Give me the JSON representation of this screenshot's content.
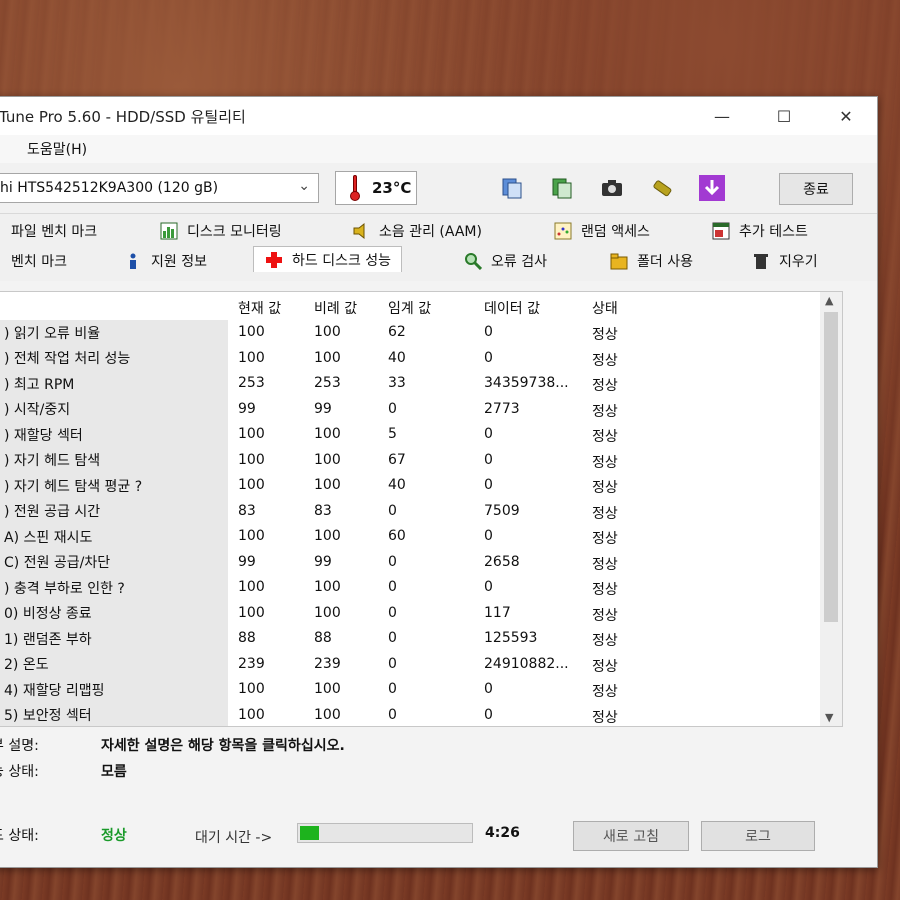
{
  "window": {
    "title": "Tune Pro 5.60 - HDD/SSD 유틸리티",
    "minimize": "—",
    "maximize": "☐",
    "close": "✕"
  },
  "menu": {
    "help": "도움말(H)"
  },
  "toolbar": {
    "drive": "hi HTS542512K9A300 (120 gB)",
    "temperature": "23°C",
    "exit_label": "종료"
  },
  "tabs": {
    "row1": [
      "파일 벤치 마크",
      "디스크 모니터링",
      "소음 관리 (AAM)",
      "랜덤 액세스",
      "추가 테스트"
    ],
    "row2": [
      "벤치 마크",
      "지원 정보",
      "하드 디스크 성능",
      "오류 검사",
      "폴더 사용",
      "지우기"
    ]
  },
  "grid": {
    "headers": [
      "현재 값",
      "비례 값",
      "임계 값",
      "데이터 값",
      "상태"
    ],
    "rows": [
      {
        "name": ") 읽기 오류 비율",
        "cur": "100",
        "worst": "100",
        "thr": "62",
        "raw": "0",
        "status": "정상"
      },
      {
        "name": ") 전체 작업 처리 성능",
        "cur": "100",
        "worst": "100",
        "thr": "40",
        "raw": "0",
        "status": "정상"
      },
      {
        "name": ") 최고 RPM",
        "cur": "253",
        "worst": "253",
        "thr": "33",
        "raw": "34359738...",
        "status": "정상"
      },
      {
        "name": ") 시작/중지",
        "cur": "99",
        "worst": "99",
        "thr": "0",
        "raw": "2773",
        "status": "정상"
      },
      {
        "name": ") 재할당 섹터",
        "cur": "100",
        "worst": "100",
        "thr": "5",
        "raw": "0",
        "status": "정상"
      },
      {
        "name": ") 자기 헤드 탐색",
        "cur": "100",
        "worst": "100",
        "thr": "67",
        "raw": "0",
        "status": "정상"
      },
      {
        "name": ") 자기 헤드 탐색 평균 ?",
        "cur": "100",
        "worst": "100",
        "thr": "40",
        "raw": "0",
        "status": "정상"
      },
      {
        "name": ") 전원 공급 시간",
        "cur": "83",
        "worst": "83",
        "thr": "0",
        "raw": "7509",
        "status": "정상"
      },
      {
        "name": "A) 스핀 재시도",
        "cur": "100",
        "worst": "100",
        "thr": "60",
        "raw": "0",
        "status": "정상"
      },
      {
        "name": "C) 전원 공급/차단",
        "cur": "99",
        "worst": "99",
        "thr": "0",
        "raw": "2658",
        "status": "정상"
      },
      {
        "name": ") 충격 부하로 인한 ?",
        "cur": "100",
        "worst": "100",
        "thr": "0",
        "raw": "0",
        "status": "정상"
      },
      {
        "name": "0) 비정상 종료",
        "cur": "100",
        "worst": "100",
        "thr": "0",
        "raw": "117",
        "status": "정상"
      },
      {
        "name": "1) 랜덤존 부하",
        "cur": "88",
        "worst": "88",
        "thr": "0",
        "raw": "125593",
        "status": "정상"
      },
      {
        "name": "2) 온도",
        "cur": "239",
        "worst": "239",
        "thr": "0",
        "raw": "24910882...",
        "status": "정상"
      },
      {
        "name": "4) 재할당 리맵핑",
        "cur": "100",
        "worst": "100",
        "thr": "0",
        "raw": "0",
        "status": "정상"
      },
      {
        "name": "5) 보안정 섹터",
        "cur": "100",
        "worst": "100",
        "thr": "0",
        "raw": "0",
        "status": "정상"
      }
    ]
  },
  "info": {
    "desc_label": "부 설명:",
    "desc_value": "자세한 설명은 해당 항목을 클릭하십시오.",
    "perf_label": "능 상태:",
    "perf_value": "모름"
  },
  "status": {
    "label": "드 상태:",
    "value": "정상",
    "wait_label": "대기 시간 ->",
    "progress_fraction": 0.11,
    "time": "4:26",
    "refresh_label": "새로 고침",
    "log_label": "로그"
  },
  "colors": {
    "good": "#1a9a2a",
    "progress": "#1db31d"
  }
}
